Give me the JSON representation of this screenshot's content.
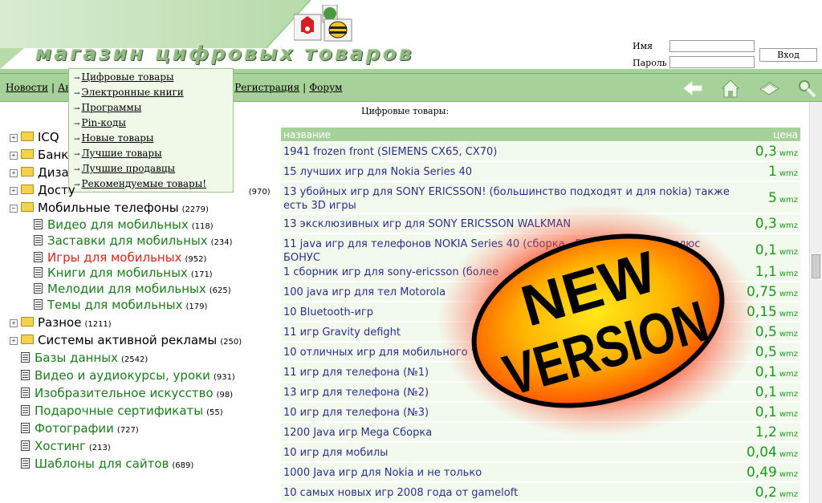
{
  "header": {
    "logo_text": "магазин цифровых товаров",
    "pay_icons": [
      "webmoney-icon",
      "mobile-payment-icon"
    ]
  },
  "login": {
    "name_label": "Имя",
    "password_label": "Пароль",
    "submit_label": "Вход",
    "name_value": "",
    "password_value": ""
  },
  "nav": {
    "links": [
      "Новости",
      "Ав",
      "о",
      "Регистрация",
      "Форум"
    ],
    "icons": [
      "back-arrow-icon",
      "home-icon",
      "mail-icon",
      "search-icon"
    ]
  },
  "dropdown": {
    "items": [
      "Цифровые товары",
      "Электронные книги",
      "Программы",
      "Pin-коды",
      "Новые товары",
      "Лучшие товары",
      "Лучшие продавцы",
      "Рекомендуемые товары!"
    ]
  },
  "tree": {
    "items": [
      {
        "label": "ICQ",
        "count": ""
      },
      {
        "label": "Банк",
        "count": ""
      },
      {
        "label": "Диза",
        "count": ""
      },
      {
        "label": "Досту",
        "count": "(970)"
      },
      {
        "label": "Мобильные телефоны",
        "count": "(2279)"
      },
      {
        "label": "Видео для мобильных",
        "count": "(118)"
      },
      {
        "label": "Заставки для мобильных",
        "count": "(234)"
      },
      {
        "label": "Игры для мобильных",
        "count": "(952)"
      },
      {
        "label": "Книги для мобильных",
        "count": "(171)"
      },
      {
        "label": "Мелодии для мобильных",
        "count": "(625)"
      },
      {
        "label": "Темы для мобильных",
        "count": "(179)"
      },
      {
        "label": "Разное",
        "count": "(1211)"
      },
      {
        "label": "Системы активной рекламы",
        "count": "(250)"
      },
      {
        "label": "Базы данных",
        "count": "(2542)"
      },
      {
        "label": "Видео и аудиокурсы, уроки",
        "count": "(931)"
      },
      {
        "label": "Изобразительное искусство",
        "count": "(98)"
      },
      {
        "label": "Подарочные сертификаты",
        "count": "(55)"
      },
      {
        "label": "Фотографии",
        "count": "(727)"
      },
      {
        "label": "Хостинг",
        "count": "(213)"
      },
      {
        "label": "Шаблоны для сайтов",
        "count": "(689)"
      }
    ]
  },
  "products": {
    "section_title": "Цифровые товары:",
    "col_name": "название",
    "col_price": "цена",
    "currency": "wmz",
    "rows": [
      {
        "name": "1941 frozen front (SIEMENS CX65, CX70)",
        "price": "0,3"
      },
      {
        "name": "15 лучших игр для Nokia Series 40",
        "price": "1"
      },
      {
        "name": "13 убойных игр для SONY ERICSSON! (большинство подходят и для nokia) также есть 3D игры",
        "price": "5"
      },
      {
        "name": "13 эксклюзивных игр для SONY ERICSSON WALKMAN",
        "price": "0,3"
      },
      {
        "name": "11 java игр для телефонов NOKIA Series 40 (сборка - Разное) Часть 4 - плюс БОНУС",
        "price": "0,1"
      },
      {
        "name": "1 сборник игр для sony-ericsson (более",
        "price": "1,1"
      },
      {
        "name": "100 java игр для тел Motorola",
        "price": "0,75"
      },
      {
        "name": "10 Bluetooth-игр",
        "price": "0,15"
      },
      {
        "name": "11 игр Gravity defight",
        "price": "0,5"
      },
      {
        "name": "10 отличных игр для мобильного телефона 128*128",
        "price": "0,5"
      },
      {
        "name": "11 игр для телефона (№1)",
        "price": "0,1"
      },
      {
        "name": "13 игр для телефона (№2)",
        "price": "0,1"
      },
      {
        "name": "10 игр для телефона (№3)",
        "price": "0,1"
      },
      {
        "name": "1200 Java игр Mega Сборка",
        "price": "1,2"
      },
      {
        "name": "10 игр для мобилы",
        "price": "0,04"
      },
      {
        "name": "1000 Java игр для Nokia и не только",
        "price": "0,49"
      },
      {
        "name": "10 самых новых игр 2008 года от gameloft",
        "price": "0,2"
      }
    ]
  },
  "badge": {
    "line1": "NEW",
    "line2": "VERSION"
  },
  "colors": {
    "accent_green": "#a6d29a",
    "link_blue": "#2c2f8a",
    "price_green": "#1b9a1b",
    "category_green": "#1b7d1b",
    "active_red": "#e0231a"
  }
}
